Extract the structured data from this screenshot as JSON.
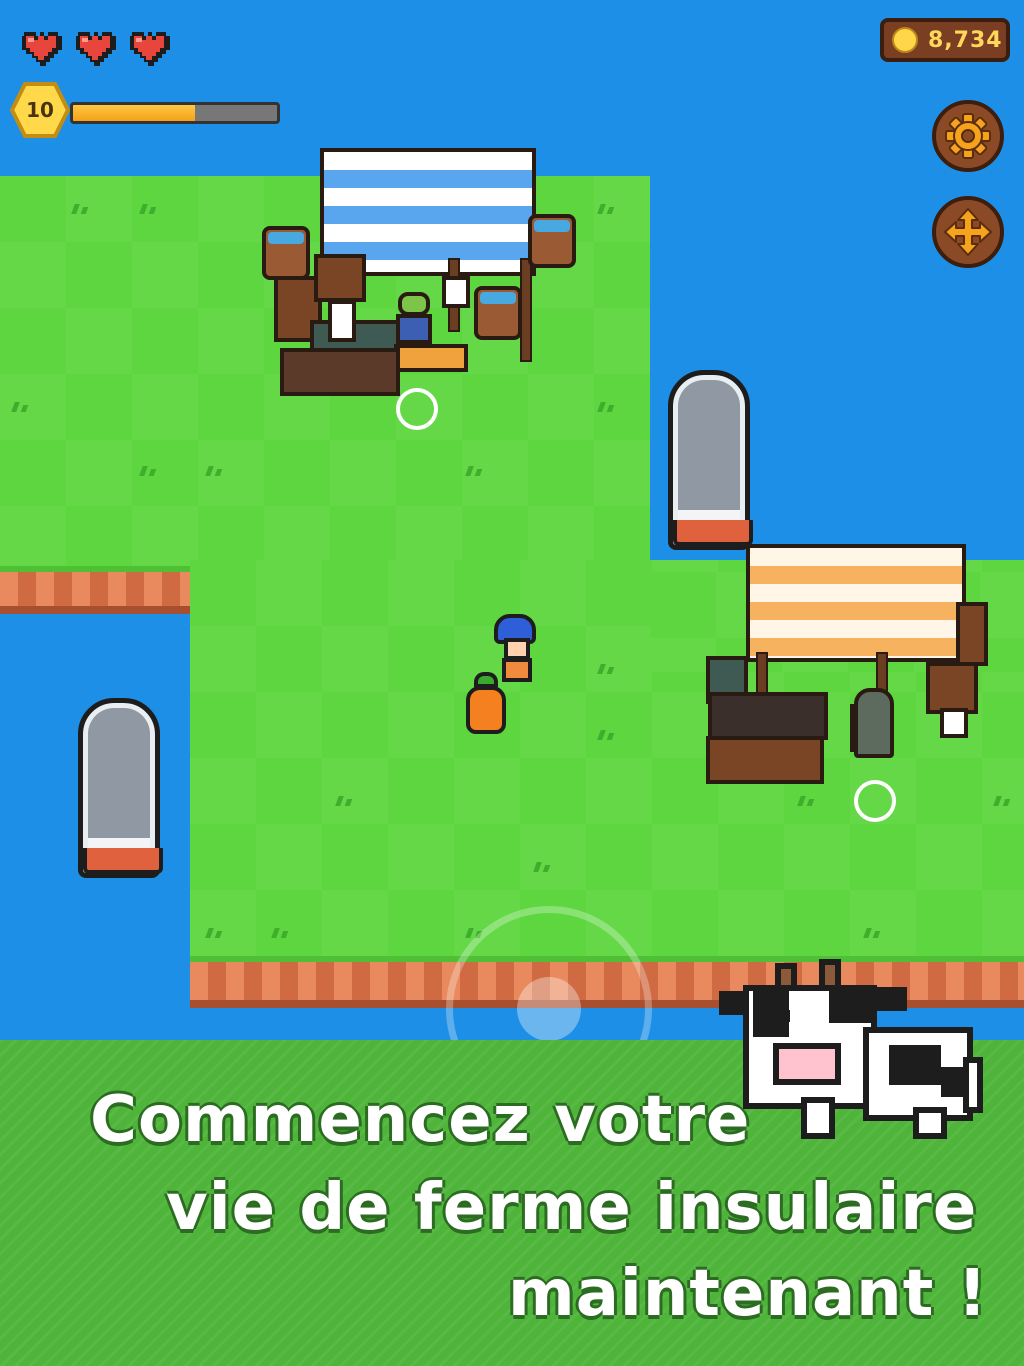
{
  "hud": {
    "hearts": 3,
    "level": "10",
    "xp_fraction": 0.6,
    "coins": "8,734",
    "colors": {
      "heart": "#e8463c",
      "xp": "#f5a017",
      "coin": "#ffd54a",
      "water": "#1e8fe6",
      "grass": "#5dd63f"
    }
  },
  "buttons": {
    "settings_icon": "gear-icon",
    "move_icon": "move-arrows-icon"
  },
  "caption": {
    "line1": "Commencez votre",
    "line2": "vie de ferme insulaire",
    "line3": "maintenant !"
  }
}
